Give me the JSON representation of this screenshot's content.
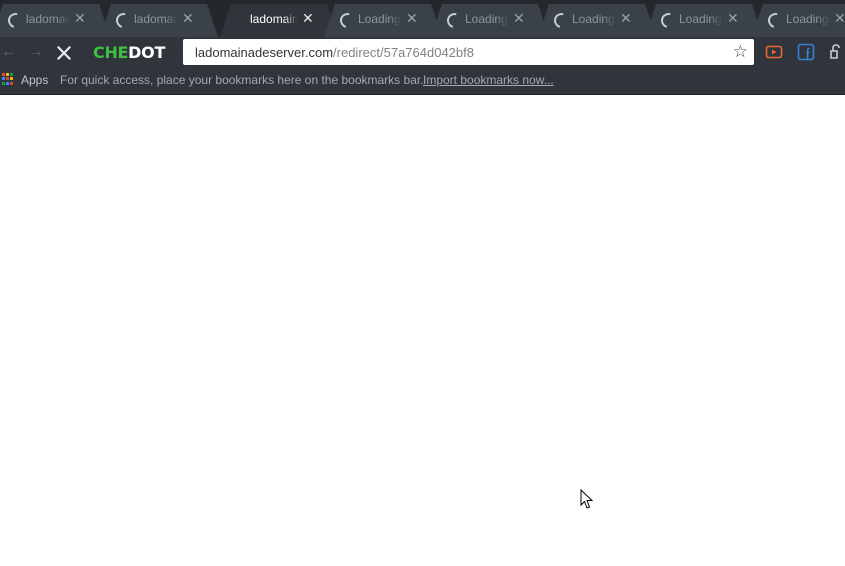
{
  "browser": {
    "brand_left": "CHE",
    "brand_right": "DOT",
    "tabs": [
      {
        "title": "ladomainadeserver",
        "state": "loading",
        "active": false
      },
      {
        "title": "ladomainadeserver",
        "state": "loading",
        "active": false
      },
      {
        "title": "ladomainadeserver",
        "state": "idle",
        "active": true
      },
      {
        "title": "Loading...",
        "state": "loading",
        "active": false
      },
      {
        "title": "Loading...",
        "state": "loading",
        "active": false
      },
      {
        "title": "Loading...",
        "state": "loading",
        "active": false
      },
      {
        "title": "Loading...",
        "state": "loading",
        "active": false
      },
      {
        "title": "Loading...",
        "state": "loading",
        "active": false
      }
    ],
    "omnibox": {
      "host": "ladomainadeserver.com",
      "path": "/redirect/57a764d042bf8"
    }
  },
  "bookmarks": {
    "apps_label": "Apps",
    "message": "For quick access, place your bookmarks here on the bookmarks bar.",
    "import_link": "Import bookmarks now..."
  },
  "colors": {
    "chrome_dark": "#24282c",
    "toolbar": "#2f353b",
    "brand_green": "#3fbf3f",
    "youtube": "#e8663a",
    "facebook": "#3b7fd6"
  }
}
